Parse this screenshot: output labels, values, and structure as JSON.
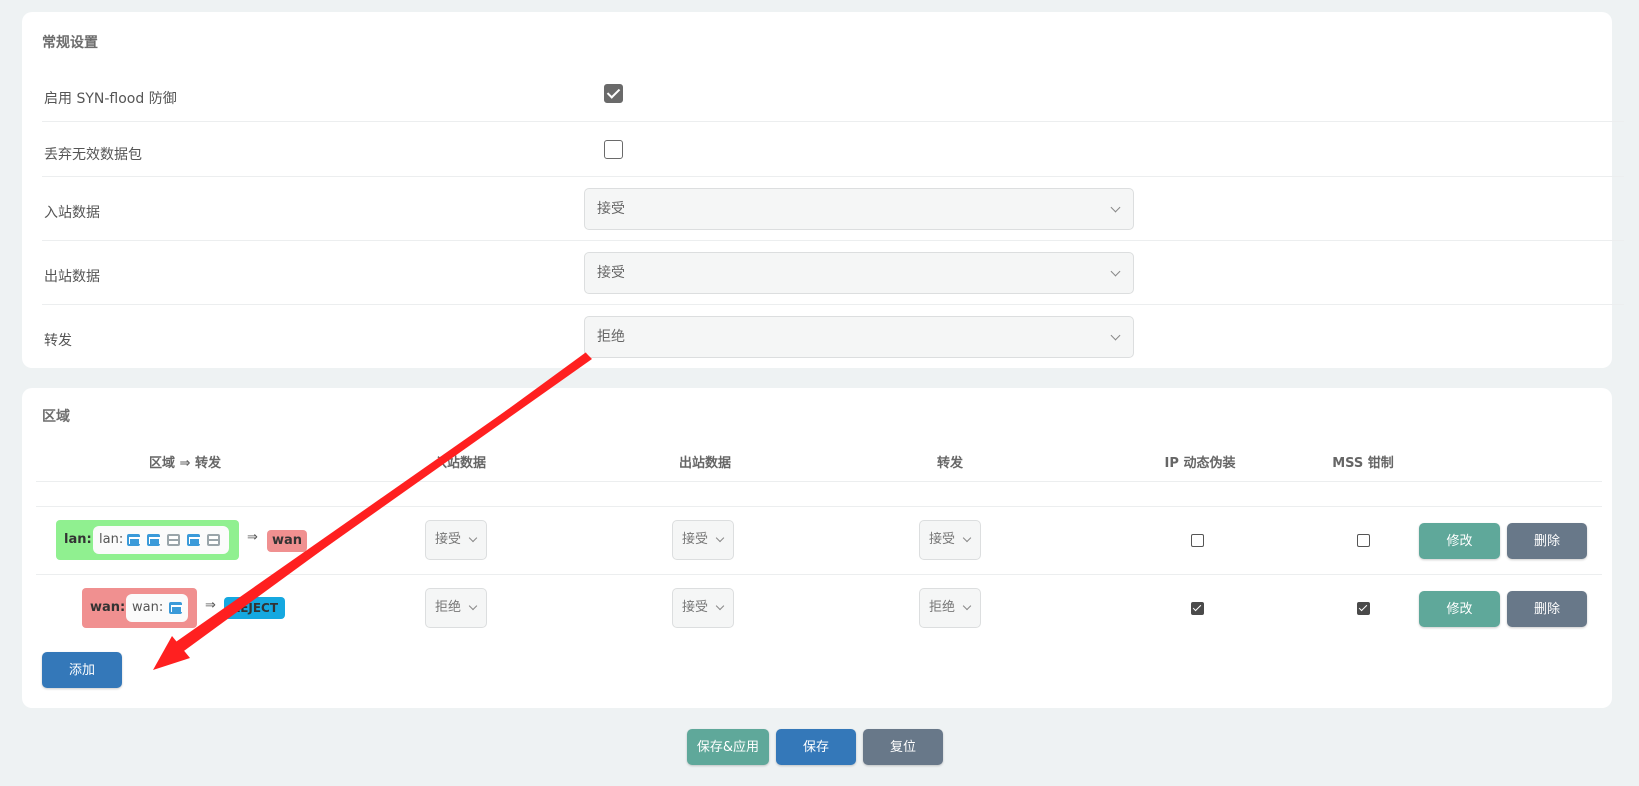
{
  "general": {
    "title": "常规设置",
    "syn_flood": {
      "label": "启用 SYN-flood 防御",
      "checked": true
    },
    "drop_invalid": {
      "label": "丢弃无效数据包",
      "checked": false
    },
    "input": {
      "label": "入站数据",
      "value": "接受"
    },
    "output": {
      "label": "出站数据",
      "value": "接受"
    },
    "forward": {
      "label": "转发",
      "value": "拒绝"
    }
  },
  "zones": {
    "title": "区域",
    "headers": {
      "zone_forward": "区域 ⇒ 转发",
      "input": "入站数据",
      "output": "出站数据",
      "forward": "转发",
      "masq": "IP 动态伪装",
      "mss": "MSS 钳制"
    },
    "rows": [
      {
        "zone": "lan:",
        "inner": "lan:",
        "arrow": "⇒",
        "target": "wan",
        "input": "接受",
        "output": "接受",
        "forward": "接受",
        "masq": false,
        "mss": false,
        "edit": "修改",
        "delete": "删除",
        "colors": {
          "zone": "#90f090",
          "target": "#f09090"
        }
      },
      {
        "zone": "wan:",
        "inner": "wan:",
        "arrow": "⇒",
        "target": "REJECT",
        "input": "拒绝",
        "output": "接受",
        "forward": "拒绝",
        "masq": true,
        "mss": true,
        "edit": "修改",
        "delete": "删除",
        "colors": {
          "zone": "#f09090",
          "target": "#15a8e0"
        }
      }
    ],
    "add": "添加"
  },
  "footer": {
    "save_apply": "保存&应用",
    "save": "保存",
    "reset": "复位"
  },
  "colors": {
    "primary": "#3478b9",
    "success": "#5fa89a",
    "neutral": "#687889",
    "annotation": "#ff2020"
  },
  "icons": [
    "network-icon",
    "server-icon",
    "wan-icon",
    "chevron-down-icon"
  ]
}
